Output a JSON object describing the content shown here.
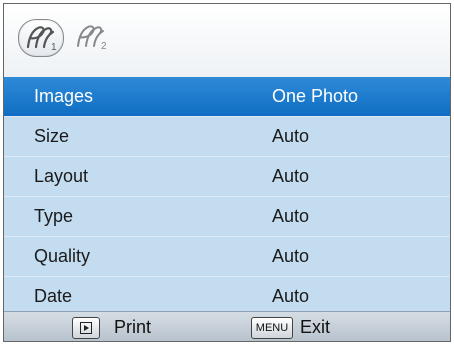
{
  "tabs": [
    {
      "icon": "pictbridge-1-icon",
      "selected": true
    },
    {
      "icon": "pictbridge-2-icon",
      "selected": false
    }
  ],
  "menu": {
    "items": [
      {
        "label": "Images",
        "value": "One Photo",
        "selected": true
      },
      {
        "label": "Size",
        "value": "Auto"
      },
      {
        "label": "Layout",
        "value": "Auto"
      },
      {
        "label": "Type",
        "value": "Auto"
      },
      {
        "label": "Quality",
        "value": "Auto"
      },
      {
        "label": "Date",
        "value": "Auto"
      }
    ]
  },
  "footer": {
    "menu_key": "MENU",
    "print_label": "Print",
    "exit_label": "Exit"
  },
  "colors": {
    "selected": "#1a79cf",
    "list_bg": "#c3dcf0"
  }
}
